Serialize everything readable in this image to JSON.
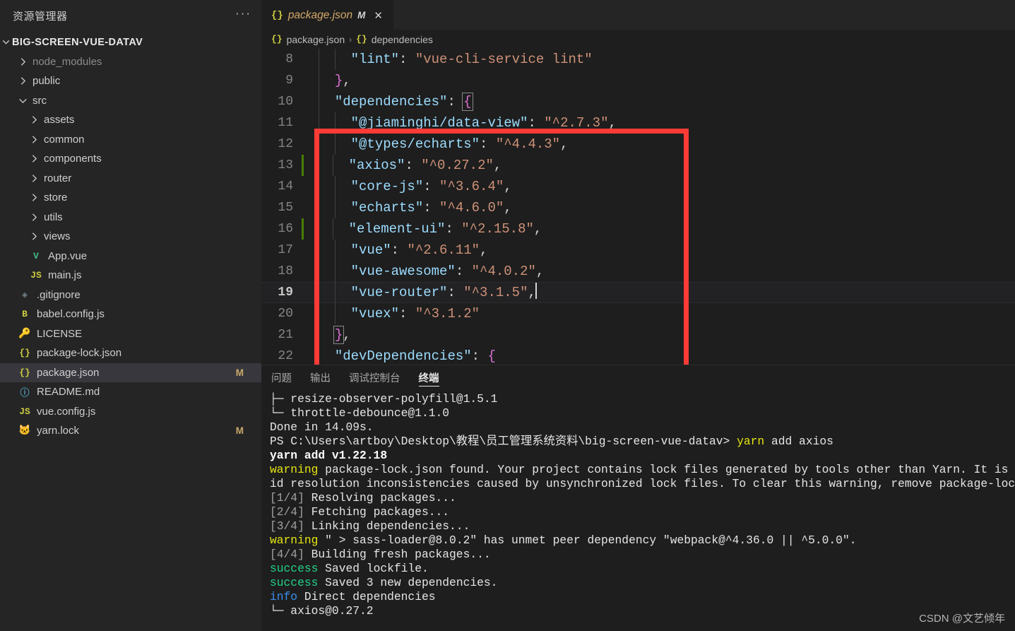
{
  "sidebar": {
    "title": "资源管理器",
    "more_actions": "···",
    "root": {
      "label": "BIG-SCREEN-VUE-DATAV",
      "expanded": true
    },
    "items": [
      {
        "label": "node_modules",
        "type": "folder",
        "expanded": false,
        "indent": 1,
        "dim": true
      },
      {
        "label": "public",
        "type": "folder",
        "expanded": false,
        "indent": 1,
        "dim": false
      },
      {
        "label": "src",
        "type": "folder",
        "expanded": true,
        "indent": 1,
        "dim": false
      },
      {
        "label": "assets",
        "type": "folder",
        "expanded": false,
        "indent": 2,
        "dim": false
      },
      {
        "label": "common",
        "type": "folder",
        "expanded": false,
        "indent": 2,
        "dim": false
      },
      {
        "label": "components",
        "type": "folder",
        "expanded": false,
        "indent": 2,
        "dim": false
      },
      {
        "label": "router",
        "type": "folder",
        "expanded": false,
        "indent": 2,
        "dim": false
      },
      {
        "label": "store",
        "type": "folder",
        "expanded": false,
        "indent": 2,
        "dim": false
      },
      {
        "label": "utils",
        "type": "folder",
        "expanded": false,
        "indent": 2,
        "dim": false
      },
      {
        "label": "views",
        "type": "folder",
        "expanded": false,
        "indent": 2,
        "dim": false
      },
      {
        "label": "App.vue",
        "type": "file",
        "icon": "vue-icon",
        "glyph": "V",
        "color": "#41b883",
        "indent": 2
      },
      {
        "label": "main.js",
        "type": "file",
        "icon": "javascript-icon",
        "glyph": "JS",
        "color": "#cbcb41",
        "indent": 2
      },
      {
        "label": ".gitignore",
        "type": "file",
        "icon": "git-icon",
        "glyph": "◈",
        "color": "#6d8086",
        "indent": 1
      },
      {
        "label": "babel.config.js",
        "type": "file",
        "icon": "babel-icon",
        "glyph": "B",
        "color": "#cbcb41",
        "indent": 1
      },
      {
        "label": "LICENSE",
        "type": "file",
        "icon": "license-icon",
        "glyph": "🔑",
        "color": "#cbcb41",
        "indent": 1
      },
      {
        "label": "package-lock.json",
        "type": "file",
        "icon": "json-icon",
        "glyph": "{}",
        "color": "#cbcb41",
        "indent": 1
      },
      {
        "label": "package.json",
        "type": "file",
        "icon": "json-icon",
        "glyph": "{}",
        "color": "#cbcb41",
        "indent": 1,
        "selected": true,
        "status": "M"
      },
      {
        "label": "README.md",
        "type": "file",
        "icon": "info-icon",
        "glyph": "ⓘ",
        "color": "#519aba",
        "indent": 1
      },
      {
        "label": "vue.config.js",
        "type": "file",
        "icon": "javascript-icon",
        "glyph": "JS",
        "color": "#cbcb41",
        "indent": 1
      },
      {
        "label": "yarn.lock",
        "type": "file",
        "icon": "yarn-icon",
        "glyph": "🐱",
        "color": "#74b0bd",
        "indent": 1,
        "status": "M"
      }
    ]
  },
  "editor": {
    "tab": {
      "icon": "json-icon",
      "icon_glyph": "{}",
      "label": "package.json",
      "modified_badge": "M",
      "close": "✕"
    },
    "breadcrumb": {
      "file_icon_glyph": "{}",
      "file": "package.json",
      "separator": "›",
      "symbol_icon_glyph": "{}",
      "symbol": "dependencies"
    },
    "lines": [
      {
        "num": "8",
        "indent_guides": 1,
        "tokens": [
          {
            "t": "    ",
            "c": "p"
          },
          {
            "t": "\"lint\"",
            "c": "k"
          },
          {
            "t": ": ",
            "c": "p"
          },
          {
            "t": "\"vue-cli-service lint\"",
            "c": "s"
          }
        ]
      },
      {
        "num": "9",
        "indent_guides": 0,
        "tokens": [
          {
            "t": "  ",
            "c": "p"
          },
          {
            "t": "}",
            "c": "b"
          },
          {
            "t": ",",
            "c": "p"
          }
        ]
      },
      {
        "num": "10",
        "indent_guides": 0,
        "tokens": [
          {
            "t": "  ",
            "c": "p"
          },
          {
            "t": "\"dependencies\"",
            "c": "k"
          },
          {
            "t": ": ",
            "c": "p"
          },
          {
            "t": "{",
            "c": "b bracketbox"
          }
        ]
      },
      {
        "num": "11",
        "indent_guides": 1,
        "tokens": [
          {
            "t": "    ",
            "c": "p"
          },
          {
            "t": "\"@jiaminghi/data-view\"",
            "c": "k"
          },
          {
            "t": ": ",
            "c": "p"
          },
          {
            "t": "\"^2.7.3\"",
            "c": "s"
          },
          {
            "t": ",",
            "c": "p"
          }
        ]
      },
      {
        "num": "12",
        "indent_guides": 1,
        "tokens": [
          {
            "t": "    ",
            "c": "p"
          },
          {
            "t": "\"@types/echarts\"",
            "c": "k"
          },
          {
            "t": ": ",
            "c": "p"
          },
          {
            "t": "\"^4.4.3\"",
            "c": "s"
          },
          {
            "t": ",",
            "c": "p"
          }
        ]
      },
      {
        "num": "13",
        "indent_guides": 1,
        "git": "modified",
        "tokens": [
          {
            "t": "    ",
            "c": "p"
          },
          {
            "t": "\"axios\"",
            "c": "k"
          },
          {
            "t": ": ",
            "c": "p"
          },
          {
            "t": "\"^0.27.2\"",
            "c": "s"
          },
          {
            "t": ",",
            "c": "p"
          }
        ]
      },
      {
        "num": "14",
        "indent_guides": 1,
        "tokens": [
          {
            "t": "    ",
            "c": "p"
          },
          {
            "t": "\"core-js\"",
            "c": "k"
          },
          {
            "t": ": ",
            "c": "p"
          },
          {
            "t": "\"^3.6.4\"",
            "c": "s"
          },
          {
            "t": ",",
            "c": "p"
          }
        ]
      },
      {
        "num": "15",
        "indent_guides": 1,
        "tokens": [
          {
            "t": "    ",
            "c": "p"
          },
          {
            "t": "\"echarts\"",
            "c": "k"
          },
          {
            "t": ": ",
            "c": "p"
          },
          {
            "t": "\"^4.6.0\"",
            "c": "s"
          },
          {
            "t": ",",
            "c": "p"
          }
        ]
      },
      {
        "num": "16",
        "indent_guides": 1,
        "git": "modified",
        "tokens": [
          {
            "t": "    ",
            "c": "p"
          },
          {
            "t": "\"element-ui\"",
            "c": "k"
          },
          {
            "t": ": ",
            "c": "p"
          },
          {
            "t": "\"^2.15.8\"",
            "c": "s"
          },
          {
            "t": ",",
            "c": "p"
          }
        ]
      },
      {
        "num": "17",
        "indent_guides": 1,
        "tokens": [
          {
            "t": "    ",
            "c": "p"
          },
          {
            "t": "\"vue\"",
            "c": "k"
          },
          {
            "t": ": ",
            "c": "p"
          },
          {
            "t": "\"^2.6.11\"",
            "c": "s"
          },
          {
            "t": ",",
            "c": "p"
          }
        ]
      },
      {
        "num": "18",
        "indent_guides": 1,
        "tokens": [
          {
            "t": "    ",
            "c": "p"
          },
          {
            "t": "\"vue-awesome\"",
            "c": "k"
          },
          {
            "t": ": ",
            "c": "p"
          },
          {
            "t": "\"^4.0.2\"",
            "c": "s"
          },
          {
            "t": ",",
            "c": "p"
          }
        ]
      },
      {
        "num": "19",
        "indent_guides": 1,
        "active": true,
        "caret": true,
        "tokens": [
          {
            "t": "    ",
            "c": "p"
          },
          {
            "t": "\"vue-router\"",
            "c": "k"
          },
          {
            "t": ": ",
            "c": "p"
          },
          {
            "t": "\"^3.1.5\"",
            "c": "s"
          },
          {
            "t": ",",
            "c": "p"
          }
        ]
      },
      {
        "num": "20",
        "indent_guides": 1,
        "tokens": [
          {
            "t": "    ",
            "c": "p"
          },
          {
            "t": "\"vuex\"",
            "c": "k"
          },
          {
            "t": ": ",
            "c": "p"
          },
          {
            "t": "\"^3.1.2\"",
            "c": "s"
          }
        ]
      },
      {
        "num": "21",
        "indent_guides": 0,
        "tokens": [
          {
            "t": "  ",
            "c": "p"
          },
          {
            "t": "}",
            "c": "b bracketbox"
          },
          {
            "t": ",",
            "c": "p"
          }
        ]
      },
      {
        "num": "22",
        "indent_guides": 0,
        "tokens": [
          {
            "t": "  ",
            "c": "p"
          },
          {
            "t": "\"devDependencies\"",
            "c": "k"
          },
          {
            "t": ": ",
            "c": "p"
          },
          {
            "t": "{",
            "c": "b"
          }
        ]
      }
    ],
    "highlight_box_color": "#ff3b36"
  },
  "panel": {
    "tabs": [
      {
        "label": "问题",
        "active": false
      },
      {
        "label": "输出",
        "active": false
      },
      {
        "label": "调试控制台",
        "active": false
      },
      {
        "label": "终端",
        "active": true
      }
    ],
    "terminal_lines": [
      [
        {
          "t": "├─ resize-observer-polyfill@1.5.1",
          "c": "t-white"
        }
      ],
      [
        {
          "t": "└─ throttle-debounce@1.1.0",
          "c": "t-white"
        }
      ],
      [
        {
          "t": "Done in 14.09s.",
          "c": "t-white"
        }
      ],
      [
        {
          "t": "PS C:\\Users\\artboy\\Desktop\\教程\\员工管理系统资料\\big-screen-vue-datav> ",
          "c": "t-white"
        },
        {
          "t": "yarn",
          "c": "t-yellow"
        },
        {
          "t": " add axios",
          "c": "t-white"
        }
      ],
      [
        {
          "t": "yarn add v1.22.18",
          "c": "t-bold"
        }
      ],
      [
        {
          "t": "warning",
          "c": "t-yellow"
        },
        {
          "t": " package-lock.json found. Your project contains lock files generated by tools other than Yarn. It is advised",
          "c": "t-white"
        }
      ],
      [
        {
          "t": "id resolution inconsistencies caused by unsynchronized lock files. To clear this warning, remove package-lock.json.",
          "c": "t-white"
        }
      ],
      [
        {
          "t": "[1/4]",
          "c": "t-dim"
        },
        {
          "t": " Resolving packages...",
          "c": "t-white"
        }
      ],
      [
        {
          "t": "[2/4]",
          "c": "t-dim"
        },
        {
          "t": " Fetching packages...",
          "c": "t-white"
        }
      ],
      [
        {
          "t": "[3/4]",
          "c": "t-dim"
        },
        {
          "t": " Linking dependencies...",
          "c": "t-white"
        }
      ],
      [
        {
          "t": "warning",
          "c": "t-yellow"
        },
        {
          "t": " \" > sass-loader@8.0.2\" has unmet peer dependency \"webpack@^4.36.0 || ^5.0.0\".",
          "c": "t-white"
        }
      ],
      [
        {
          "t": "[4/4]",
          "c": "t-dim"
        },
        {
          "t": " Building fresh packages...",
          "c": "t-white"
        }
      ],
      [
        {
          "t": "success",
          "c": "t-green"
        },
        {
          "t": " Saved lockfile.",
          "c": "t-white"
        }
      ],
      [
        {
          "t": "success",
          "c": "t-green"
        },
        {
          "t": " Saved 3 new dependencies.",
          "c": "t-white"
        }
      ],
      [
        {
          "t": "info",
          "c": "t-blue"
        },
        {
          "t": " Direct dependencies",
          "c": "t-white"
        }
      ],
      [
        {
          "t": "└─ axios@0.27.2",
          "c": "t-white"
        }
      ]
    ]
  },
  "watermark": "CSDN @文艺倾年"
}
